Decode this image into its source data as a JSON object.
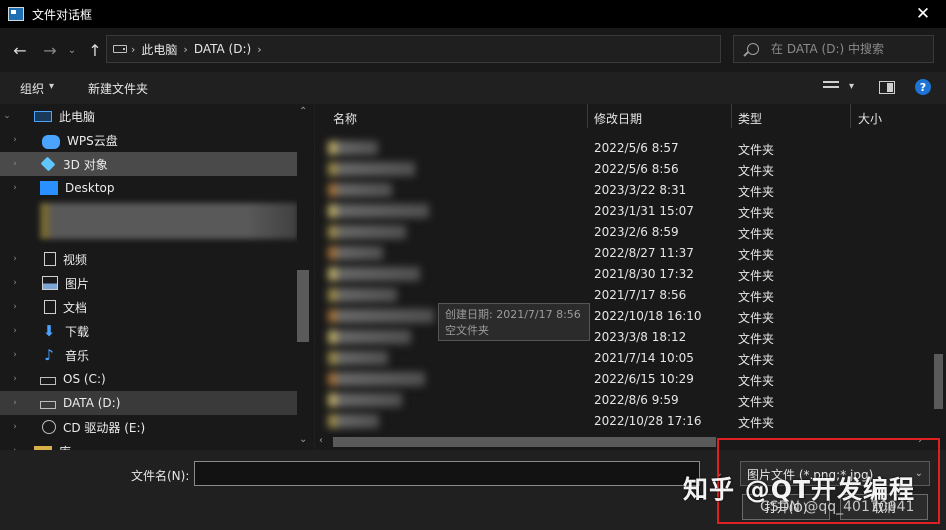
{
  "window": {
    "title": "文件对话框",
    "close": "✕"
  },
  "nav": {
    "back": "←",
    "forward": "→",
    "recent": "⌄",
    "up": "↑",
    "breadcrumb": [
      "此电脑",
      "DATA (D:)"
    ],
    "separator": "›",
    "dropdown": "⌄",
    "refresh": "↻",
    "search_placeholder": "在 DATA (D:) 中搜索"
  },
  "toolbar": {
    "organize": "组织",
    "organize_arrow": "▾",
    "new_folder": "新建文件夹",
    "view_arrow": "▾",
    "help": "?"
  },
  "tree": [
    {
      "label": "此电脑",
      "icon": "pc-icon",
      "state": "normal"
    },
    {
      "label": "WPS云盘",
      "icon": "cloud-icon",
      "state": "normal"
    },
    {
      "label": "3D 对象",
      "icon": "3d-objects-icon",
      "state": "selected"
    },
    {
      "label": "Desktop",
      "icon": "desktop-icon",
      "state": "normal"
    },
    {
      "label": "视频",
      "icon": "video-icon",
      "state": "normal"
    },
    {
      "label": "图片",
      "icon": "pictures-icon",
      "state": "normal"
    },
    {
      "label": "文档",
      "icon": "documents-icon",
      "state": "normal"
    },
    {
      "label": "下载",
      "icon": "download-icon",
      "state": "normal"
    },
    {
      "label": "音乐",
      "icon": "music-icon",
      "state": "normal"
    },
    {
      "label": "OS (C:)",
      "icon": "drive-icon",
      "state": "normal"
    },
    {
      "label": "DATA (D:)",
      "icon": "drive-icon",
      "state": "highlighted"
    },
    {
      "label": "CD 驱动器 (E:)",
      "icon": "cd-drive-icon",
      "state": "normal"
    },
    {
      "label": "库",
      "icon": "folder-icon",
      "state": "normal"
    }
  ],
  "columns": {
    "name": "名称",
    "date": "修改日期",
    "type": "类型",
    "size": "大小",
    "sort_arrow": "^"
  },
  "files": [
    {
      "date": "2022/5/6 8:57",
      "type": "文件夹"
    },
    {
      "date": "2022/5/6 8:56",
      "type": "文件夹"
    },
    {
      "date": "2023/3/22 8:31",
      "type": "文件夹"
    },
    {
      "date": "2023/1/31 15:07",
      "type": "文件夹"
    },
    {
      "date": "2023/2/6 8:59",
      "type": "文件夹"
    },
    {
      "date": "2022/8/27 11:37",
      "type": "文件夹"
    },
    {
      "date": "2021/8/30 17:32",
      "type": "文件夹"
    },
    {
      "date": "2021/7/17 8:56",
      "type": "文件夹"
    },
    {
      "date": "2022/10/18 16:10",
      "type": "文件夹"
    },
    {
      "date": "2023/3/8 18:12",
      "type": "文件夹"
    },
    {
      "date": "2021/7/14 10:05",
      "type": "文件夹"
    },
    {
      "date": "2022/6/15 10:29",
      "type": "文件夹"
    },
    {
      "date": "2022/8/6 9:59",
      "type": "文件夹"
    },
    {
      "date": "2022/10/28 17:16",
      "type": "文件夹"
    }
  ],
  "tooltip": {
    "line1": "创建日期: 2021/7/17 8:56",
    "line2": "空文件夹"
  },
  "bottom": {
    "filename_label": "文件名(N):",
    "filename_value": "",
    "filter": "图片文件 (*.png;*.jpg)",
    "open": "打开(O)",
    "cancel": "取消"
  },
  "watermark": {
    "main": "知乎 @QT开发编程",
    "sub": "CSDN @qq_40170041"
  }
}
